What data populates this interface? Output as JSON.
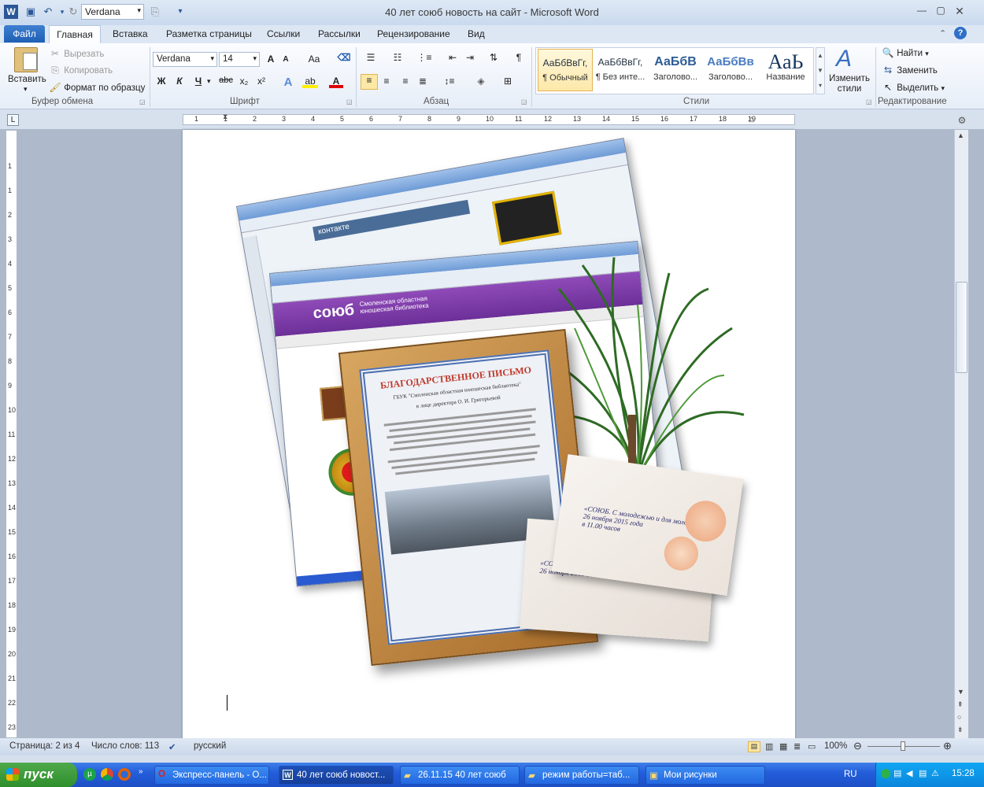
{
  "window": {
    "title": "40 лет союб новость на сайт  -  Microsoft Word",
    "font_combo": "Verdana"
  },
  "tabs": [
    "Файл",
    "Главная",
    "Вставка",
    "Разметка страницы",
    "Ссылки",
    "Рассылки",
    "Рецензирование",
    "Вид"
  ],
  "clipboard": {
    "paste": "Вставить",
    "cut": "Вырезать",
    "copy": "Копировать",
    "format_painter": "Формат по образцу",
    "label": "Буфер обмена"
  },
  "font_group": {
    "font_name": "Verdana",
    "font_size": "14",
    "label": "Шрифт",
    "bold": "Ж",
    "italic": "К",
    "underline": "Ч",
    "strike": "abc",
    "grow": "A",
    "case": "Aa"
  },
  "paragraph_group": {
    "label": "Абзац"
  },
  "styles": {
    "items": [
      {
        "sample": "АаБбВвГг,",
        "name": "¶ Обычный"
      },
      {
        "sample": "АаБбВвГг,",
        "name": "¶ Без инте..."
      },
      {
        "sample": "АаБбВ",
        "name": "Заголово..."
      },
      {
        "sample": "АаБбВв",
        "name": "Заголово..."
      },
      {
        "sample": "АаЬ",
        "name": "Название"
      }
    ],
    "change": "Изменить стили",
    "label": "Стили"
  },
  "editing": {
    "find": "Найти",
    "replace": "Заменить",
    "select": "Выделить",
    "label": "Редактирование"
  },
  "ruler": {
    "h_numbers": [
      "1",
      "1",
      "2",
      "3",
      "4",
      "5",
      "6",
      "7",
      "8",
      "9",
      "10",
      "11",
      "12",
      "13",
      "14",
      "15",
      "16",
      "17",
      "18",
      "19"
    ],
    "v_numbers": [
      "1",
      "1",
      "2",
      "3",
      "4",
      "5",
      "6",
      "7",
      "8",
      "9",
      "10",
      "11",
      "12",
      "13",
      "14",
      "15",
      "16",
      "17",
      "18",
      "19",
      "20",
      "21",
      "22",
      "23"
    ]
  },
  "collage": {
    "site_logo": "союб",
    "site_name": "Смоленская областная юношеская библиотека",
    "vk_logo": "контакте",
    "letter_title": "БЛАГОДАРСТВЕННОЕ ПИСЬМО",
    "letter_org": "ГБУК \"Смоленская областная юношеская библиотека\"",
    "letter_director": "в лице директора О. И. Григорьевой",
    "invite_date": "26 ноября 2015 года",
    "invite_time": "в 11.00 часов",
    "invite_name": "«СОЮБ. С молодежью и для молодежи»"
  },
  "status": {
    "page": "Страница: 2 из 4",
    "words": "Число слов: 113",
    "language": "русский",
    "zoom": "100%"
  },
  "taskbar": {
    "start": "пуск",
    "items": [
      "Экспресс-панель - О...",
      "40 лет союб новост...",
      "26.11.15 40 лет союб",
      "режим работы=таб...",
      "Мои рисунки"
    ],
    "lang": "RU",
    "time": "15:28"
  }
}
